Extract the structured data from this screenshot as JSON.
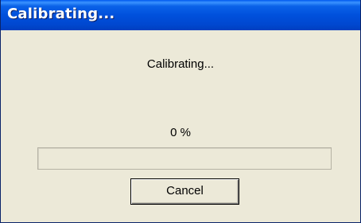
{
  "window": {
    "title": "Calibrating..."
  },
  "dialog": {
    "message": "Calibrating...",
    "percent_text": "0 %",
    "progress_fraction": 0.0,
    "cancel_label": "Cancel"
  },
  "colors": {
    "title_bar": "#0050dc",
    "face": "#ece9d8",
    "progress_fill": "#2bb32b"
  }
}
